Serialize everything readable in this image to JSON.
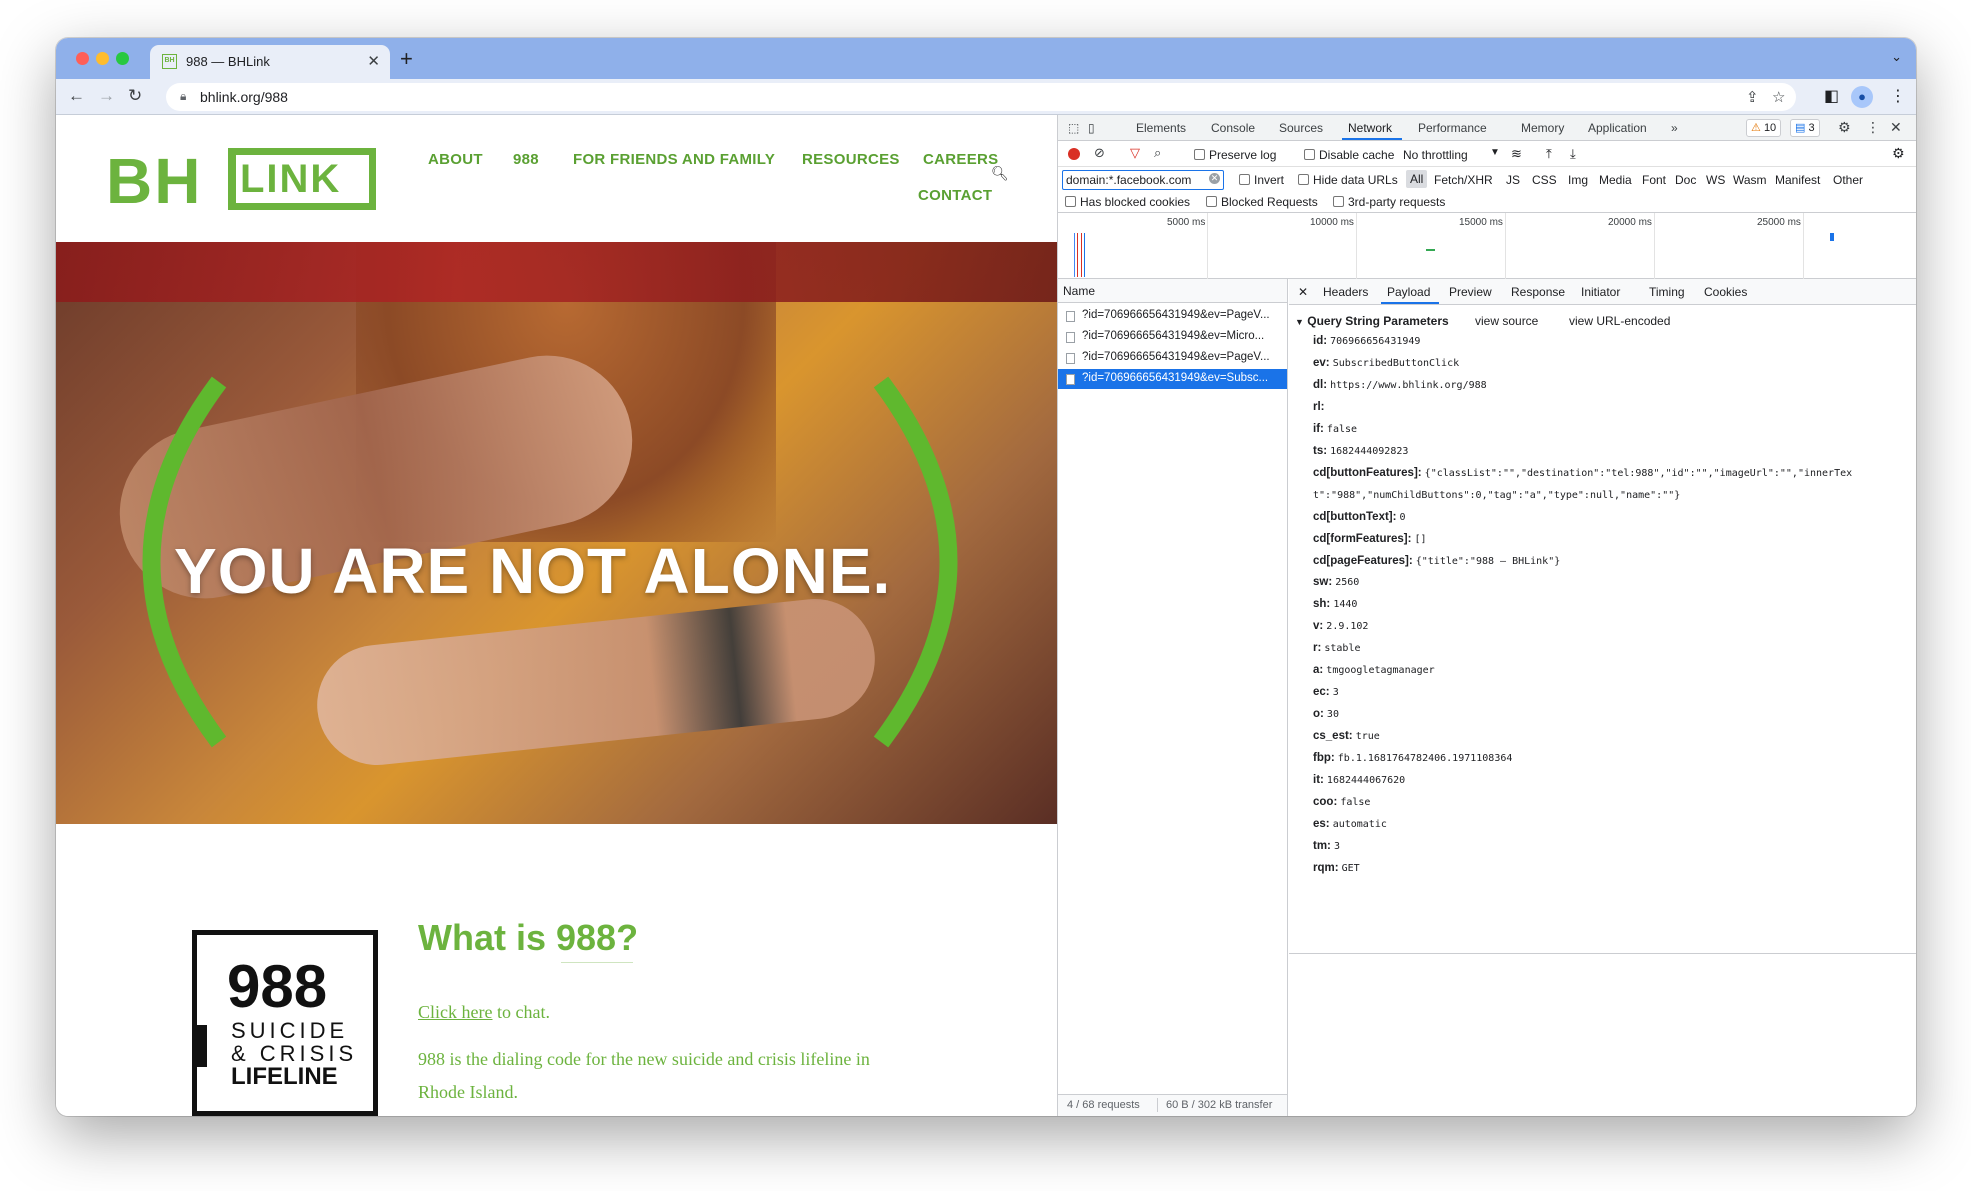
{
  "browser": {
    "tab_title": "988 — BHLink",
    "tab_favicon_text": "BH",
    "url": "bhlink.org/988"
  },
  "site": {
    "logo_left": "BH",
    "logo_right": "LINK",
    "nav": [
      "ABOUT",
      "988",
      "FOR FRIENDS AND FAMILY",
      "RESOURCES",
      "CAREERS",
      "CONTACT"
    ],
    "hero_title": "YOU ARE NOT ALONE.",
    "section_title": "What is 988?",
    "chat_link": "Click here",
    "chat_suffix": " to chat.",
    "desc_line1": "988 is the dialing code for the new suicide and crisis lifeline in",
    "desc_line2": "Rhode Island.",
    "lifeline_number": "988",
    "lifeline_l1": "SUICIDE",
    "lifeline_l2": "& CRISIS",
    "lifeline_l3": "LIFELINE",
    "accent": "#6cb33e"
  },
  "devtools": {
    "tabs": [
      "Elements",
      "Console",
      "Sources",
      "Network",
      "Performance",
      "Memory",
      "Application"
    ],
    "active_tab": "Network",
    "warnings": "10",
    "messages": "3",
    "preserve_log": "Preserve log",
    "disable_cache": "Disable cache",
    "throttling": "No throttling",
    "filter_value": "domain:*.facebook.com",
    "invert": "Invert",
    "hide_data_urls": "Hide data URLs",
    "type_filters": [
      "All",
      "Fetch/XHR",
      "JS",
      "CSS",
      "Img",
      "Media",
      "Font",
      "Doc",
      "WS",
      "Wasm",
      "Manifest",
      "Other"
    ],
    "has_blocked_cookies": "Has blocked cookies",
    "blocked_requests": "Blocked Requests",
    "third_party": "3rd-party requests",
    "timeline_labels": [
      "5000 ms",
      "10000 ms",
      "15000 ms",
      "20000 ms",
      "25000 ms"
    ],
    "list_header": "Name",
    "requests": [
      "?id=706966656431949&ev=PageV...",
      "?id=706966656431949&ev=Micro...",
      "?id=706966656431949&ev=PageV...",
      "?id=706966656431949&ev=Subsc..."
    ],
    "status_requests": "4 / 68 requests",
    "status_transfer": "60 B / 302 kB transfer",
    "detail_tabs": [
      "Headers",
      "Payload",
      "Preview",
      "Response",
      "Initiator",
      "Timing",
      "Cookies"
    ],
    "detail_active": "Payload",
    "qs_header": "Query String Parameters",
    "view_source": "view source",
    "view_url_encoded": "view URL-encoded",
    "params": [
      {
        "k": "id:",
        "v": "706966656431949"
      },
      {
        "k": "ev:",
        "v": "SubscribedButtonClick"
      },
      {
        "k": "dl:",
        "v": "https://www.bhlink.org/988"
      },
      {
        "k": "rl:",
        "v": ""
      },
      {
        "k": "if:",
        "v": "false"
      },
      {
        "k": "ts:",
        "v": "1682444092823"
      },
      {
        "k": "cd[buttonFeatures]:",
        "v": "{\"classList\":\"\",\"destination\":\"tel:988\",\"id\":\"\",\"imageUrl\":\"\",\"innerTex"
      },
      {
        "k": "",
        "v": "t\":\"988\",\"numChildButtons\":0,\"tag\":\"a\",\"type\":null,\"name\":\"\"}"
      },
      {
        "k": "cd[buttonText]:",
        "v": "0"
      },
      {
        "k": "cd[formFeatures]:",
        "v": "[]"
      },
      {
        "k": "cd[pageFeatures]:",
        "v": "{\"title\":\"988 — BHLink\"}"
      },
      {
        "k": "sw:",
        "v": "2560"
      },
      {
        "k": "sh:",
        "v": "1440"
      },
      {
        "k": "v:",
        "v": "2.9.102"
      },
      {
        "k": "r:",
        "v": "stable"
      },
      {
        "k": "a:",
        "v": "tmgoogletagmanager"
      },
      {
        "k": "ec:",
        "v": "3"
      },
      {
        "k": "o:",
        "v": "30"
      },
      {
        "k": "cs_est:",
        "v": "true"
      },
      {
        "k": "fbp:",
        "v": "fb.1.1681764782406.1971108364"
      },
      {
        "k": "it:",
        "v": "1682444067620"
      },
      {
        "k": "coo:",
        "v": "false"
      },
      {
        "k": "es:",
        "v": "automatic"
      },
      {
        "k": "tm:",
        "v": "3"
      },
      {
        "k": "rqm:",
        "v": "GET"
      }
    ]
  }
}
